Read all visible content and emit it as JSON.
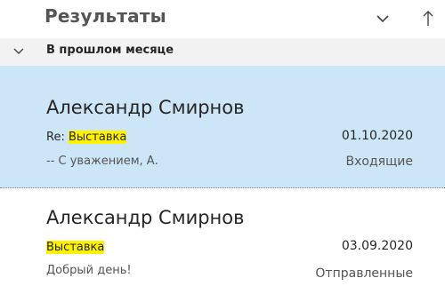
{
  "header": {
    "title": "Результаты",
    "sort_icon": "chevron-down-icon",
    "direction_icon": "arrow-up-icon"
  },
  "group": {
    "label": "В прошлом месяце",
    "icon": "chevron-down-icon"
  },
  "messages": [
    {
      "sender": "Александр Смирнов",
      "subject_prefix": "Re: ",
      "subject_highlight": "Выставка",
      "date": "01.10.2020",
      "preview": "-- С уважением, А.",
      "folder": "Входящие",
      "selected": true
    },
    {
      "sender": "Александр Смирнов",
      "subject_prefix": "",
      "subject_highlight": "Выставка",
      "date": "03.09.2020",
      "preview": "Добрый день!",
      "folder": "Отправленные",
      "selected": false
    }
  ],
  "colors": {
    "selected_bg": "#cde6f7",
    "highlight": "#fff200",
    "group_bg": "#f2f2f2",
    "text_primary": "#262626",
    "text_secondary": "#555555"
  }
}
